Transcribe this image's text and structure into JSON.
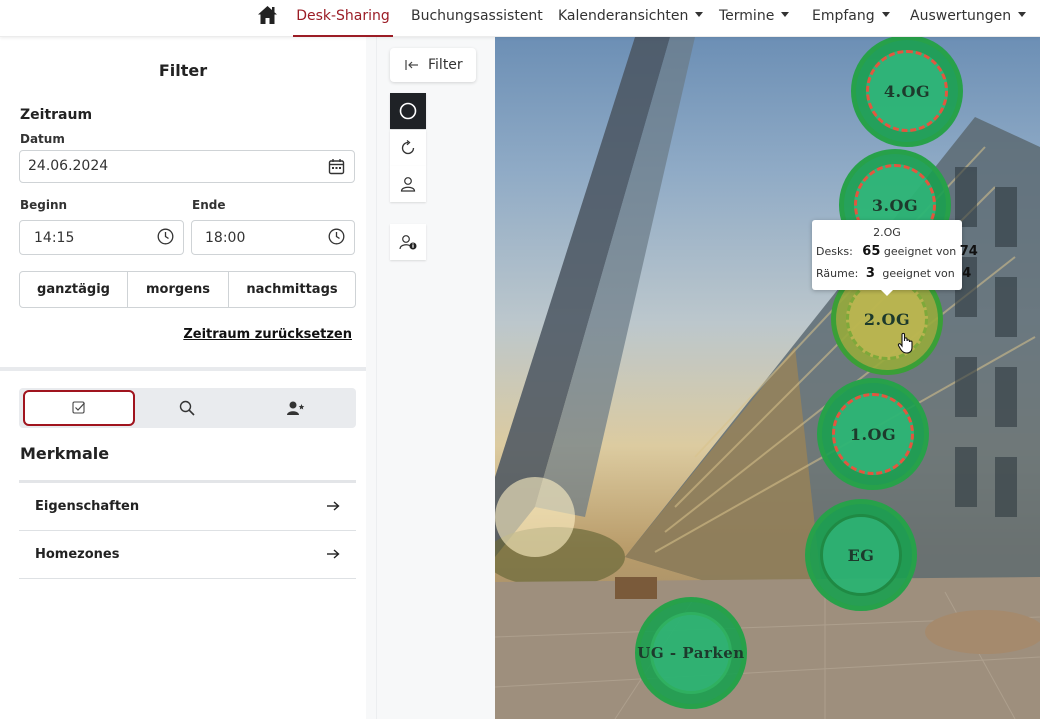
{
  "nav": {
    "items": [
      {
        "label": "Desk-Sharing"
      },
      {
        "label": "Buchungsassistent"
      },
      {
        "label": "Kalenderansichten"
      },
      {
        "label": "Termine"
      },
      {
        "label": "Empfang"
      },
      {
        "label": "Auswertungen"
      }
    ]
  },
  "filter": {
    "title": "Filter",
    "zeitraum": "Zeitraum",
    "datum_label": "Datum",
    "datum_value": "24.06.2024",
    "beginn_label": "Beginn",
    "beginn_value": "14:15",
    "ende_label": "Ende",
    "ende_value": "18:00",
    "seg": [
      "ganztägig",
      "morgens",
      "nachmittags"
    ],
    "reset": "Zeitraum zurücksetzen",
    "merkmale": "Merkmale",
    "list": [
      "Eigenschaften",
      "Homezones"
    ]
  },
  "toolbar": {
    "filter_label": "Filter"
  },
  "floors": [
    "4.OG",
    "3.OG",
    "2.OG",
    "1.OG",
    "EG",
    "UG - Parken"
  ],
  "tooltip": {
    "title": "2.OG",
    "desks_label": "Desks:",
    "desks_count": "65",
    "desks_of": "geeignet von",
    "desks_total": "74",
    "rooms_label": "Räume:",
    "rooms_count": "3",
    "rooms_of": "geeignet von",
    "rooms_total": "4"
  },
  "colors": {
    "accent": "#9b1c25",
    "floor_green": "#27a14a",
    "floor_ring": "#e4563f"
  }
}
